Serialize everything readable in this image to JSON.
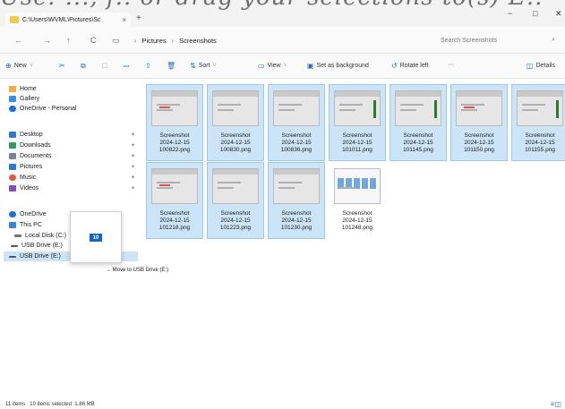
{
  "overlay": {
    "text": "Use: ..., f.. or drag your selections to(s) E.."
  },
  "window": {
    "tab_title": "C:\\Users\\WVML\\Pictures\\Sc",
    "tab_close": "×",
    "new_tab": "+",
    "minimize": "−",
    "maximize": "□",
    "close": "✕"
  },
  "nav": {
    "back": "←",
    "forward": "→",
    "up": "↑",
    "refresh": "C",
    "breadcrumbs": [
      "Pictures",
      "Screenshots"
    ],
    "search_placeholder": "Search Screenshots"
  },
  "toolbar": {
    "new": "New",
    "sort": "Sort",
    "view": "View",
    "set_background": "Set as background",
    "rotate_left": "Rotate left",
    "more": "···",
    "details": "Details"
  },
  "sidebar": {
    "items": [
      {
        "label": "Home",
        "icon": "home-icon"
      },
      {
        "label": "Gallery",
        "icon": "gallery-icon"
      },
      {
        "label": "OneDrive - Personal",
        "icon": "cloud-icon"
      },
      {
        "label": "Desktop",
        "icon": "desktop-icon"
      },
      {
        "label": "Downloads",
        "icon": "download-icon"
      },
      {
        "label": "Documents",
        "icon": "document-icon"
      },
      {
        "label": "Pictures",
        "icon": "pictures-icon"
      },
      {
        "label": "Music",
        "icon": "music-icon"
      },
      {
        "label": "Videos",
        "icon": "videos-icon"
      },
      {
        "label": "OneDrive",
        "icon": "cloud-icon"
      },
      {
        "label": "This PC",
        "icon": "pc-icon"
      },
      {
        "label": "Local Disk (C:)",
        "icon": "disk-icon"
      },
      {
        "label": "USB Drive (E:)",
        "icon": "usb-icon"
      },
      {
        "label": "USB Drive (E:)",
        "icon": "usb-icon"
      }
    ]
  },
  "drag": {
    "count": "10",
    "tooltip": "→ Move to USB Drive (E:)"
  },
  "files": [
    {
      "name": [
        "Screenshot",
        "2024-12-15",
        "100822.png"
      ],
      "selected": true,
      "style": "red"
    },
    {
      "name": [
        "Screenshot",
        "2024-12-15",
        "100830.png"
      ],
      "selected": true,
      "style": "plain"
    },
    {
      "name": [
        "Screenshot",
        "2024-12-15",
        "100836.png"
      ],
      "selected": true,
      "style": "plain"
    },
    {
      "name": [
        "Screenshot",
        "2024-12-15",
        "101011.png"
      ],
      "selected": true,
      "style": "green"
    },
    {
      "name": [
        "Screenshot",
        "2024-12-15",
        "101145.png"
      ],
      "selected": true,
      "style": "green"
    },
    {
      "name": [
        "Screenshot",
        "2024-12-15",
        "101150.png"
      ],
      "selected": true,
      "style": "red"
    },
    {
      "name": [
        "Screenshot",
        "2024-12-15",
        "101155.png"
      ],
      "selected": true,
      "style": "green"
    },
    {
      "name": [
        "Screenshot",
        "2024-12-15",
        "101218.png"
      ],
      "selected": true,
      "style": "red"
    },
    {
      "name": [
        "Screenshot",
        "2024-12-15",
        "101223.png"
      ],
      "selected": true,
      "style": "plain"
    },
    {
      "name": [
        "Screenshot",
        "2024-12-15",
        "101230.png"
      ],
      "selected": true,
      "style": "plain"
    },
    {
      "name": [
        "Screenshot",
        "2024-12-15",
        "101248.png"
      ],
      "selected": false,
      "style": "blue"
    }
  ],
  "status": {
    "items": "11 items",
    "selected": "10 items selected",
    "size": "1.86 MB"
  },
  "colors": {
    "selection": "#cce4f7",
    "selection_border": "#99c9ef",
    "accent": "#1565c0",
    "folder": "#f4c74d"
  }
}
